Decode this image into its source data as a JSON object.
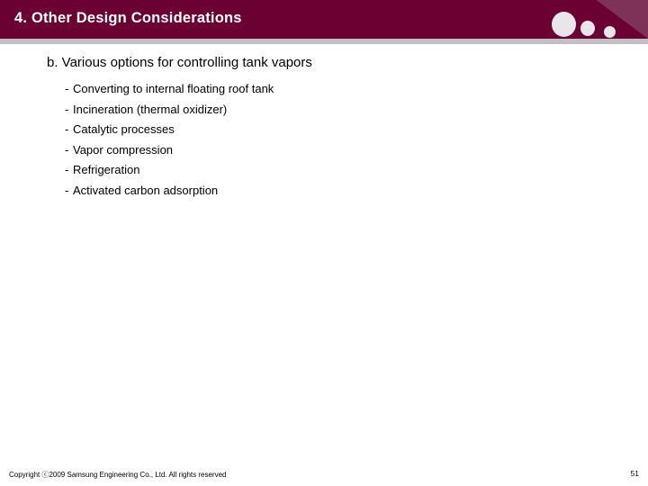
{
  "slide": {
    "header": {
      "title": "4. Other Design Considerations",
      "band_color": "#6B0033",
      "triangle_color": "#7E3258",
      "dot_color": "#E8E6EA",
      "underbar_color": "#C3C0C4",
      "title_color": "#FFFFFF"
    },
    "body": {
      "section_heading": "b. Various options for controlling tank vapors",
      "bullets": [
        {
          "dash": "-",
          "text": "Converting to internal floating roof tank"
        },
        {
          "dash": "-",
          "text": "Incineration (thermal oxidizer)"
        },
        {
          "dash": "-",
          "text": "Catalytic processes"
        },
        {
          "dash": "-",
          "text": "Vapor compression"
        },
        {
          "dash": "-",
          "text": "Refrigeration"
        },
        {
          "dash": "-",
          "text": "Activated carbon adsorption"
        }
      ],
      "text_color": "#000000"
    },
    "footer": {
      "copyright": "Copyright ⓒ2009 Samsung Engineering Co., Ltd. All rights reserved",
      "page_number": "51"
    }
  }
}
